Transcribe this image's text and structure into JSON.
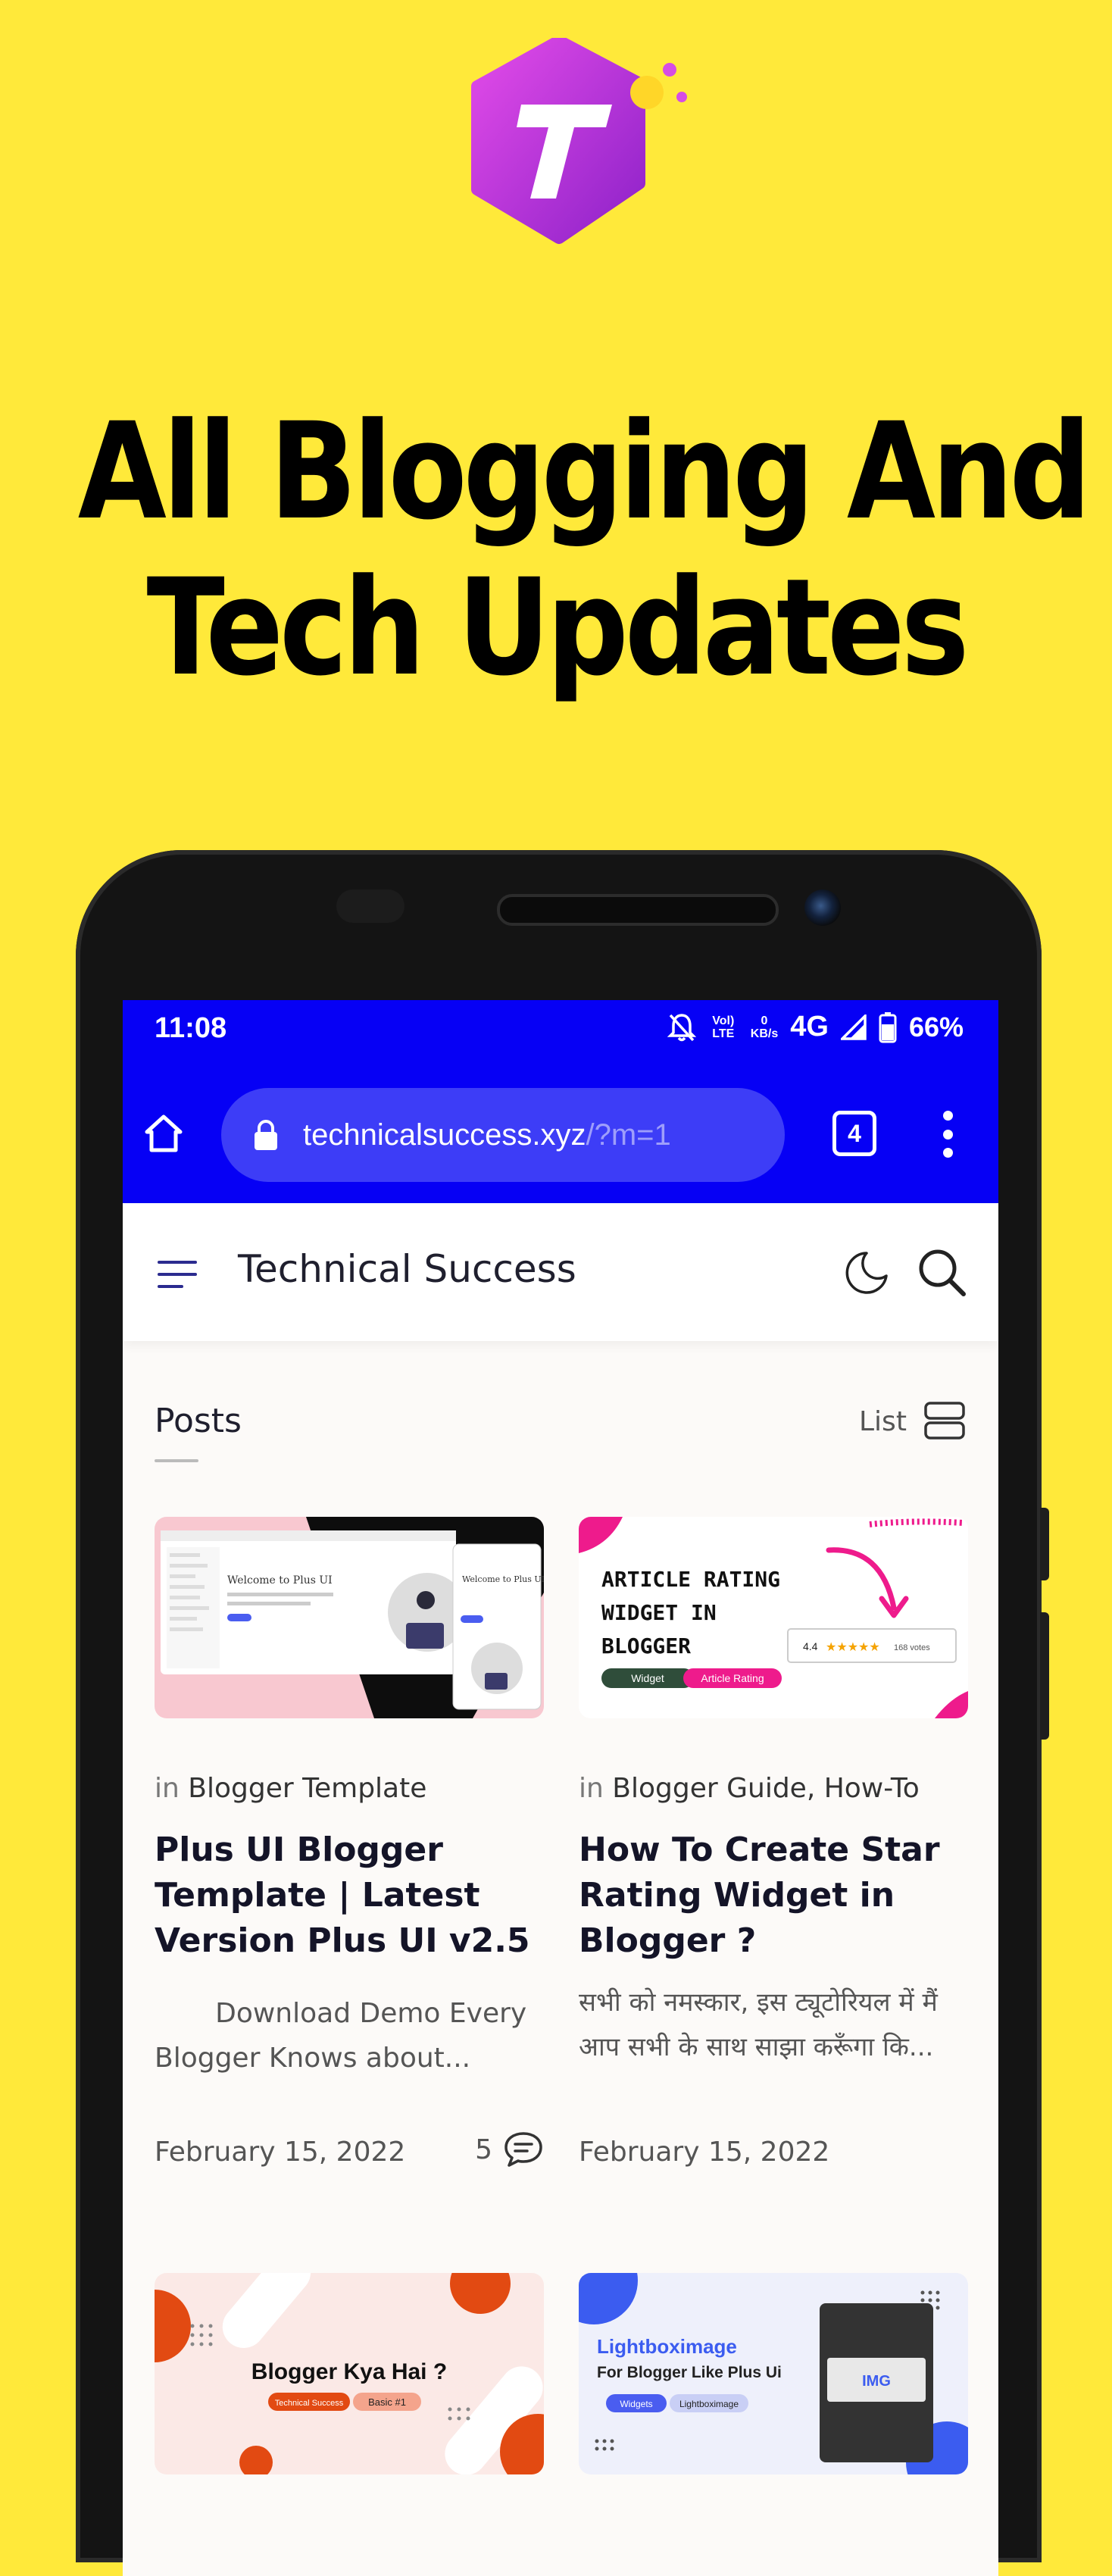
{
  "headline": {
    "line1": "All Blogging And",
    "line2": "Tech Updates"
  },
  "brand_colors": {
    "background": "#FFE93A",
    "browser_bar": "#0600F5",
    "logo": "#C13BE0"
  },
  "status_bar": {
    "time": "11:08",
    "volte": "Vol) LTE",
    "speed_value": "0",
    "speed_unit": "KB/s",
    "network": "4G",
    "battery": "66%"
  },
  "browser": {
    "url_domain": "technicalsuccess.xyz",
    "url_path": "/?m=1",
    "tab_count": "4"
  },
  "site": {
    "title": "Technical Success"
  },
  "section": {
    "heading": "Posts",
    "view_mode": "List"
  },
  "posts": [
    {
      "in_label": "in",
      "category": "Blogger Template",
      "title": "Plus UI Blogger Template | Latest Version Plus UI v2.5",
      "excerpt": "       Download Demo Every Blogger Knows about...",
      "date": "February 15, 2022",
      "comments": "5",
      "thumb": {
        "welcome": "Welcome to Plus UI"
      }
    },
    {
      "in_label": "in",
      "category": "Blogger Guide, How-To",
      "title": "How To Create Star Rating Widget in Blogger ?",
      "excerpt": "सभी को नमस्कार, इस ट्यूटोरियल में मैं आप सभी के साथ साझा करूँगा कि...",
      "date": "February 15, 2022",
      "thumb": {
        "line1": "ARTICLE RATING",
        "line2": "WIDGET IN",
        "line3": "BLOGGER",
        "tag1": "Widget",
        "tag2": "Article Rating",
        "rating": "4.4",
        "votes": "168 votes"
      }
    },
    {
      "thumb": {
        "title": "Blogger Kya Hai ?",
        "tag1": "Technical Success",
        "tag2": "Basic #1"
      }
    },
    {
      "thumb": {
        "title1": "Lightboximage",
        "title2": "For Blogger Like Plus Ui",
        "tag1": "Widgets",
        "tag2": "Lightboximage",
        "img": "IMG"
      }
    }
  ]
}
